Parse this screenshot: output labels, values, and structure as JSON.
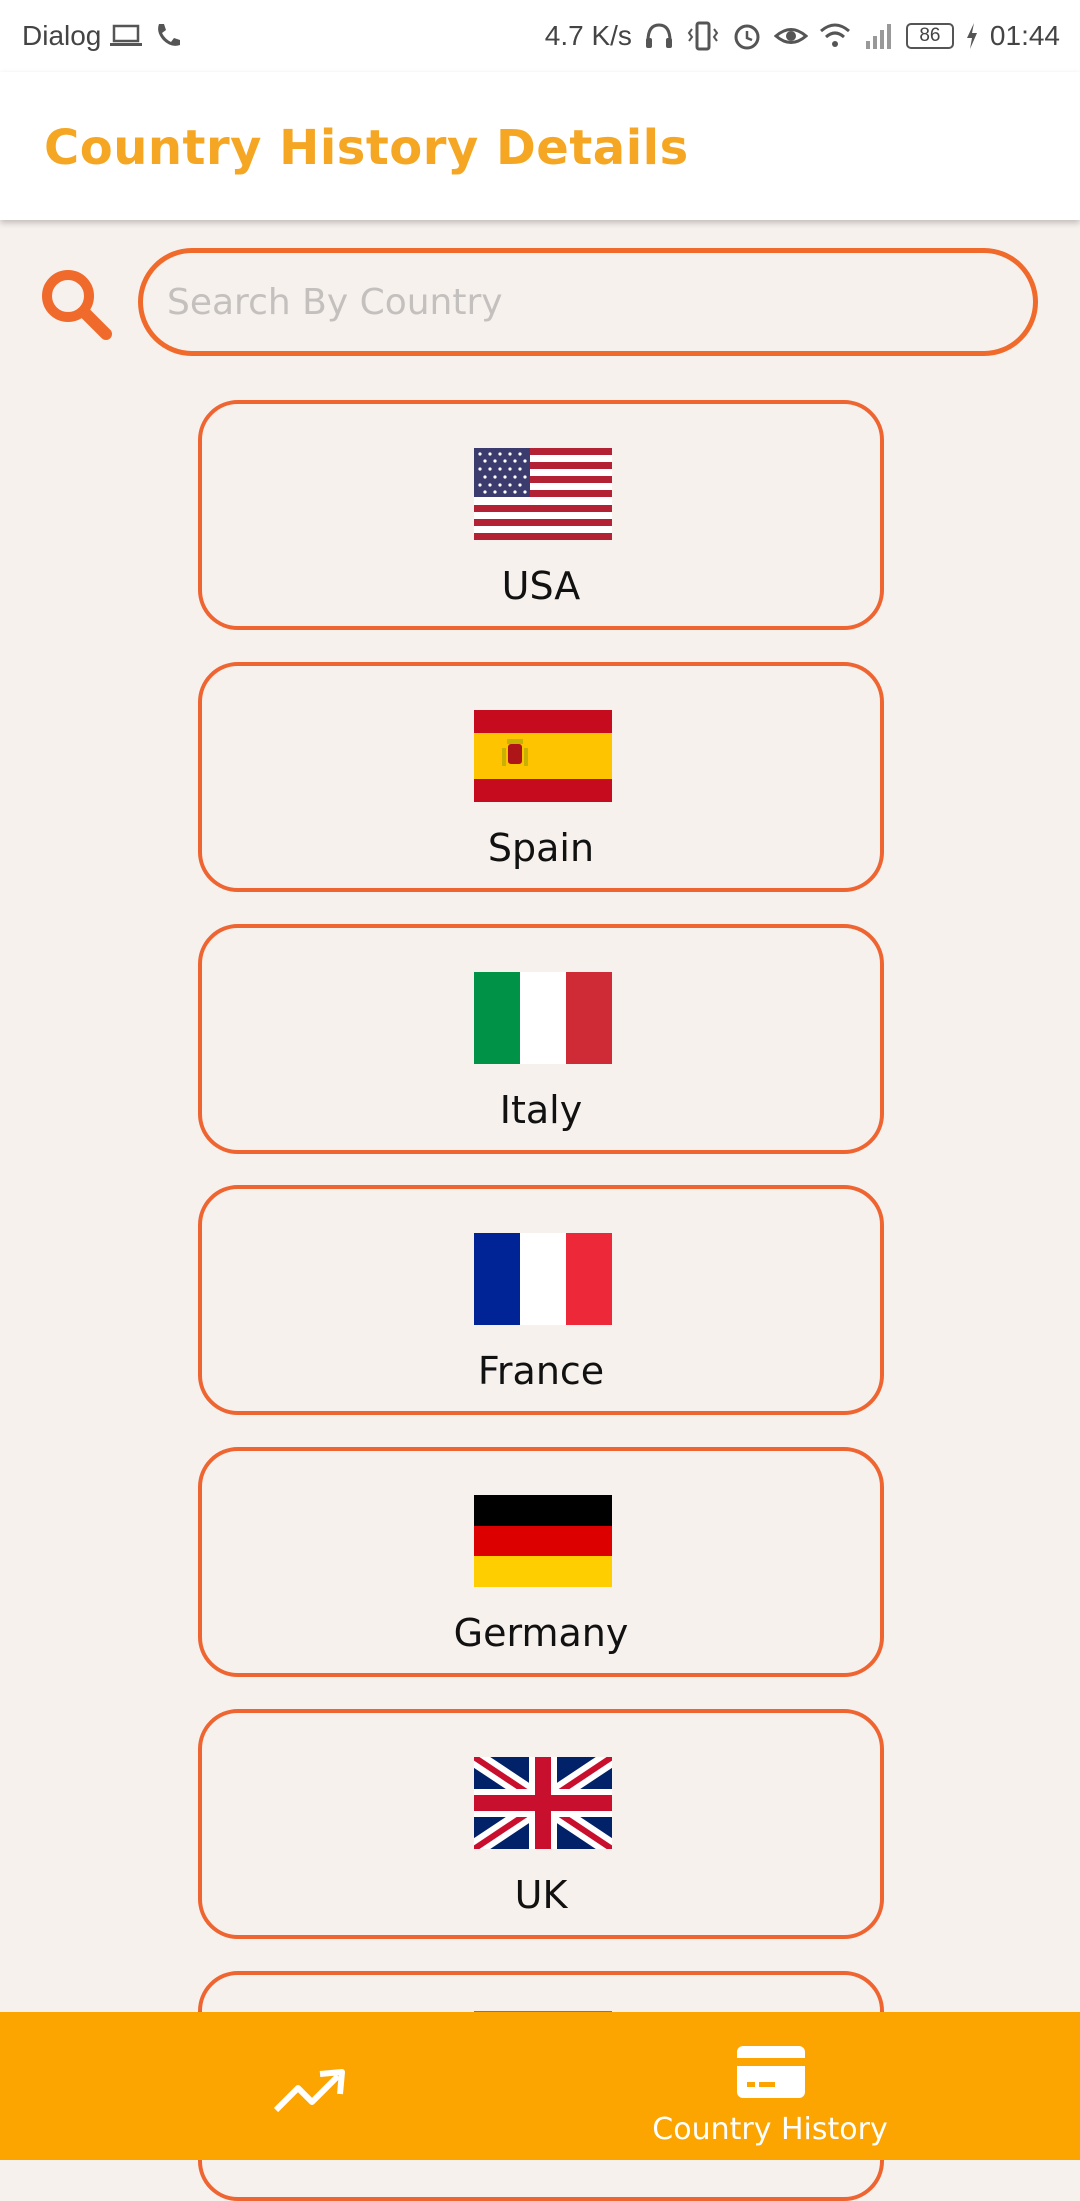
{
  "status_bar": {
    "carrier": "Dialog",
    "net_speed": "4.7 K/s",
    "battery": "86",
    "time": "01:44"
  },
  "app_bar": {
    "title": "Country History Details"
  },
  "search": {
    "placeholder": "Search By Country",
    "value": ""
  },
  "countries": [
    {
      "name": "USA",
      "flag": "usa-flag-icon"
    },
    {
      "name": "Spain",
      "flag": "spain-flag-icon"
    },
    {
      "name": "Italy",
      "flag": "italy-flag-icon"
    },
    {
      "name": "France",
      "flag": "france-flag-icon"
    },
    {
      "name": "Germany",
      "flag": "germany-flag-icon"
    },
    {
      "name": "UK",
      "flag": "uk-flag-icon"
    }
  ],
  "bottom_nav": {
    "items": [
      {
        "icon": "trending-up-icon",
        "label": ""
      },
      {
        "icon": "credit-card-icon",
        "label": "Country History"
      }
    ]
  },
  "colors": {
    "accent": "#f5a623",
    "card_border": "#ee6531",
    "bottom_nav": "#fca400",
    "background": "#f7f1ee"
  }
}
